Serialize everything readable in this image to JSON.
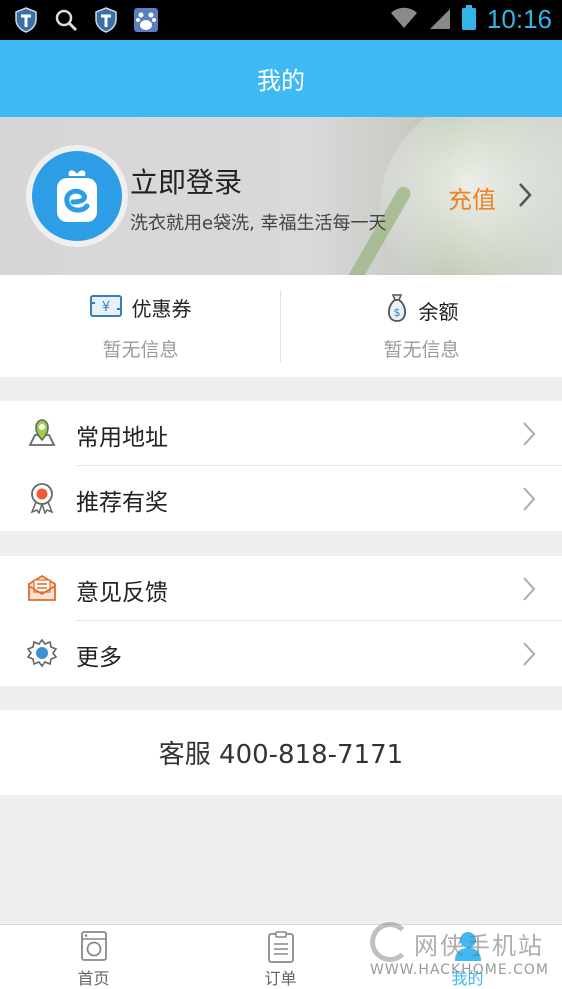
{
  "status_bar": {
    "time": "10:16",
    "icons": [
      "shield-icon",
      "search-icon",
      "shield-icon",
      "baidu-icon",
      "wifi-icon",
      "signal-icon",
      "battery-icon"
    ]
  },
  "header": {
    "title": "我的"
  },
  "profile": {
    "login_title": "立即登录",
    "subtitle": "洗衣就用e袋洗, 幸福生活每一天",
    "recharge_label": "充值"
  },
  "stats": [
    {
      "label": "优惠券",
      "value": "暂无信息",
      "icon": "coupon-icon"
    },
    {
      "label": "余额",
      "value": "暂无信息",
      "icon": "money-bag-icon"
    }
  ],
  "menu_group_1": [
    {
      "label": "常用地址",
      "icon": "location-pin-icon"
    },
    {
      "label": "推荐有奖",
      "icon": "award-ribbon-icon"
    }
  ],
  "menu_group_2": [
    {
      "label": "意见反馈",
      "icon": "envelope-icon"
    },
    {
      "label": "更多",
      "icon": "gear-icon"
    }
  ],
  "customer_service": "客服 400-818-7171",
  "tabs": [
    {
      "label": "首页",
      "icon": "washing-machine-icon"
    },
    {
      "label": "订单",
      "icon": "clipboard-icon"
    },
    {
      "label": "我的",
      "icon": "user-icon"
    }
  ],
  "colors": {
    "accent": "#3fb9f4",
    "recharge": "#f08125",
    "clock": "#34b5e5"
  },
  "watermark": {
    "line1": "网侠手机站",
    "line2": "WWW.HACKHOME.COM"
  }
}
